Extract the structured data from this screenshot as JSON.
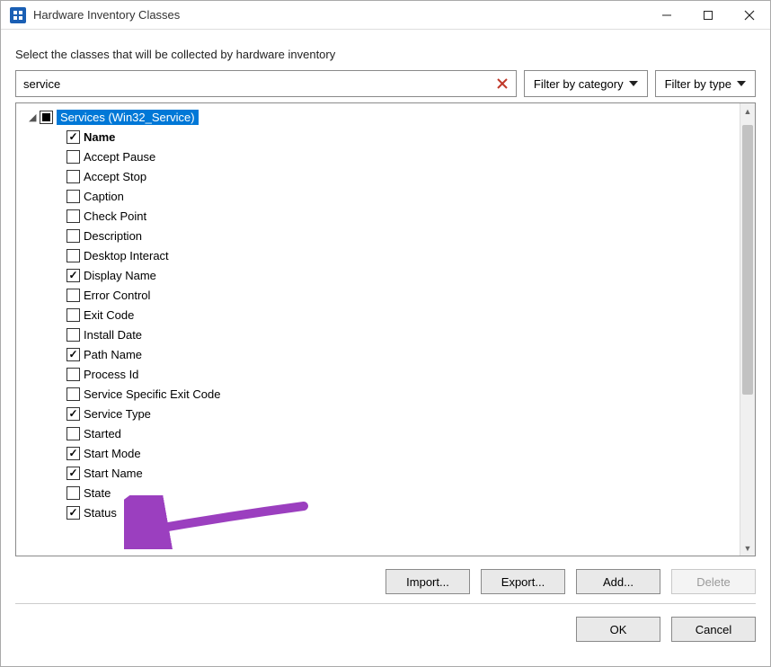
{
  "window": {
    "title": "Hardware Inventory Classes"
  },
  "instruction": "Select the classes that will be collected by hardware inventory",
  "search": {
    "value": "service"
  },
  "filters": {
    "category_label": "Filter by category",
    "type_label": "Filter by type"
  },
  "tree": {
    "root": {
      "label": "Services (Win32_Service)",
      "state": "mixed",
      "expanded": true
    },
    "items": [
      {
        "label": "Name",
        "checked": true,
        "bold": true
      },
      {
        "label": "Accept Pause",
        "checked": false,
        "bold": false
      },
      {
        "label": "Accept Stop",
        "checked": false,
        "bold": false
      },
      {
        "label": "Caption",
        "checked": false,
        "bold": false
      },
      {
        "label": "Check Point",
        "checked": false,
        "bold": false
      },
      {
        "label": "Description",
        "checked": false,
        "bold": false
      },
      {
        "label": "Desktop Interact",
        "checked": false,
        "bold": false
      },
      {
        "label": "Display Name",
        "checked": true,
        "bold": false
      },
      {
        "label": "Error Control",
        "checked": false,
        "bold": false
      },
      {
        "label": "Exit Code",
        "checked": false,
        "bold": false
      },
      {
        "label": "Install Date",
        "checked": false,
        "bold": false
      },
      {
        "label": "Path Name",
        "checked": true,
        "bold": false
      },
      {
        "label": "Process Id",
        "checked": false,
        "bold": false
      },
      {
        "label": "Service Specific Exit Code",
        "checked": false,
        "bold": false
      },
      {
        "label": "Service Type",
        "checked": true,
        "bold": false
      },
      {
        "label": "Started",
        "checked": false,
        "bold": false
      },
      {
        "label": "Start Mode",
        "checked": true,
        "bold": false
      },
      {
        "label": "Start Name",
        "checked": true,
        "bold": false
      },
      {
        "label": "State",
        "checked": false,
        "bold": false
      },
      {
        "label": "Status",
        "checked": true,
        "bold": false
      }
    ]
  },
  "buttons": {
    "import": "Import...",
    "export": "Export...",
    "add": "Add...",
    "delete": "Delete",
    "ok": "OK",
    "cancel": "Cancel"
  },
  "annotation": {
    "arrow_color": "#9b3fbf",
    "target": "State"
  }
}
